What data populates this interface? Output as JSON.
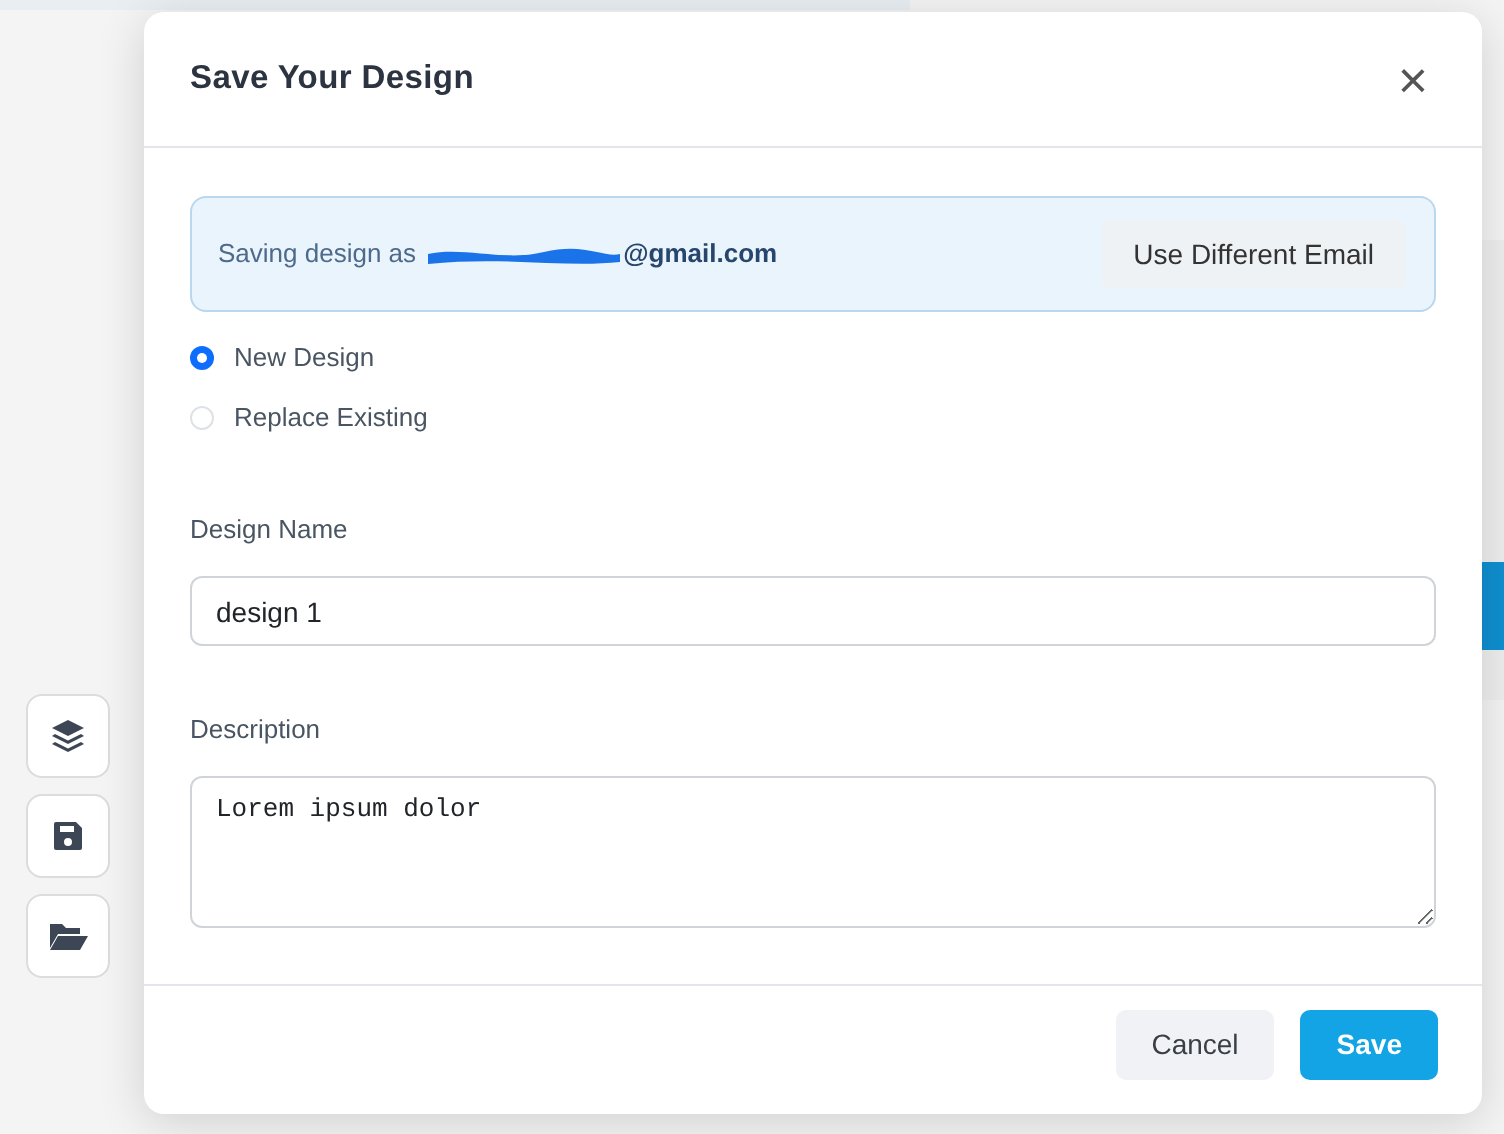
{
  "sidebar_tools": [
    {
      "kind": "layers"
    },
    {
      "kind": "save"
    },
    {
      "kind": "open"
    }
  ],
  "dialog": {
    "title": "Save Your Design",
    "close": "×",
    "account": {
      "prefix": "Saving design as",
      "email_visible": "@gmail.com",
      "button": "Use Different Email"
    },
    "options": [
      {
        "label": "New Design",
        "selected": true
      },
      {
        "label": "Replace Existing",
        "selected": false
      }
    ],
    "name_field": {
      "label": "Design Name",
      "value": "design 1"
    },
    "description_field": {
      "label": "Description",
      "value": "Lorem ipsum dolor"
    },
    "buttons": [
      {
        "label": "Cancel",
        "kind": "secondary"
      },
      {
        "label": "Save",
        "kind": "primary"
      }
    ]
  }
}
